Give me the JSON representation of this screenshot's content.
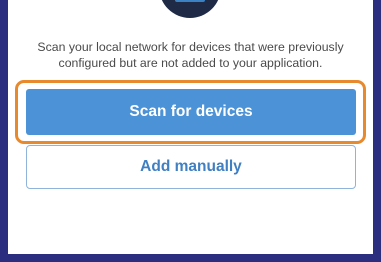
{
  "description": "Scan your local network for devices that were previously configured but are not added to your application.",
  "buttons": {
    "scan_label": "Scan for devices",
    "manual_label": "Add manually"
  },
  "colors": {
    "background": "#2b2e7e",
    "primary": "#4c92d6",
    "highlight": "#e8892d",
    "secondary_text": "#3f7fc2"
  },
  "icons": {
    "logo": "app-logo-icon"
  }
}
